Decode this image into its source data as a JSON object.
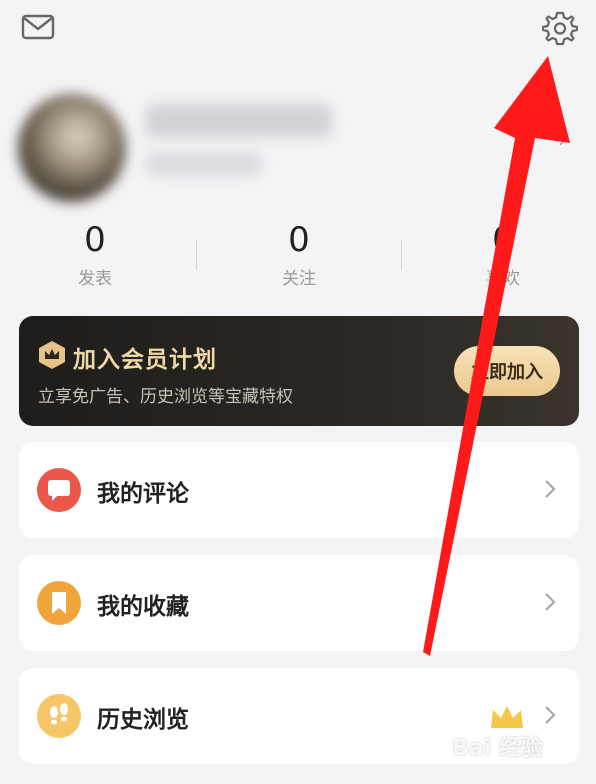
{
  "header": {
    "mail_icon": "mail-icon",
    "settings_icon": "gear-icon"
  },
  "stats": [
    {
      "value": "0",
      "label": "发表"
    },
    {
      "value": "0",
      "label": "关注"
    },
    {
      "value": "0",
      "label": "喜欢"
    }
  ],
  "vip": {
    "title": "加入会员计划",
    "description": "立享免广告、历史浏览等宝藏特权",
    "button_label": "立即加入",
    "icon": "crown-hexagon-icon"
  },
  "menu": [
    {
      "label": "我的评论",
      "icon": "comment-bubble-icon",
      "color": "#e9584a"
    },
    {
      "label": "我的收藏",
      "icon": "bookmark-icon",
      "color": "#f0a53a"
    },
    {
      "label": "历史浏览",
      "icon": "footprints-icon",
      "color": "#f5c767",
      "badge": "crown-badge-icon"
    }
  ],
  "colors": {
    "annotation_arrow": "#ff1a1a",
    "vip_gold": "#f1d8a6",
    "page_bg": "#f4f3f5"
  },
  "watermark": "Bai 经验"
}
